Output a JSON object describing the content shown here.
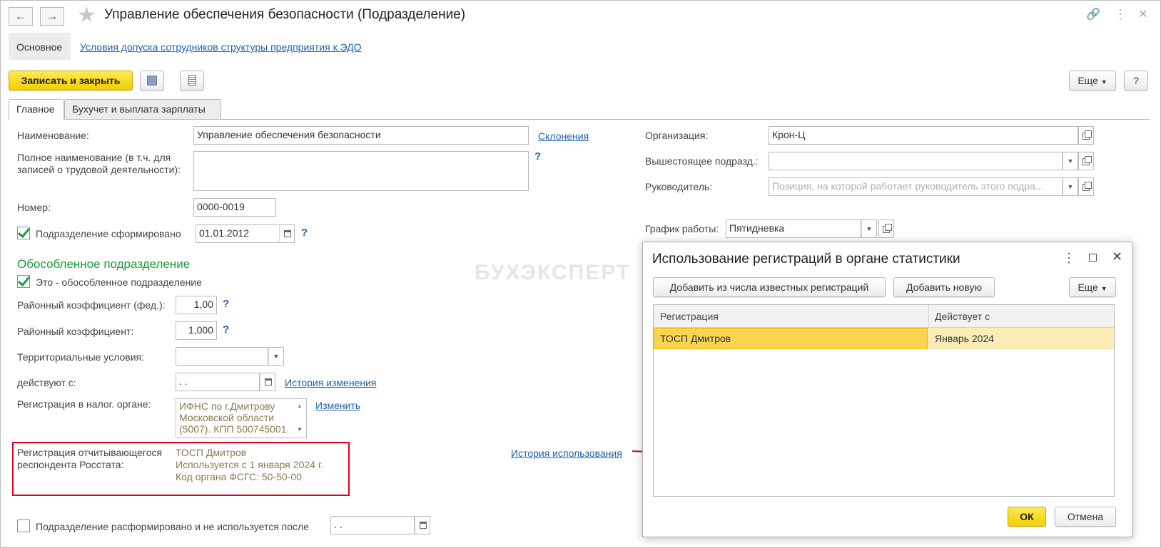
{
  "header": {
    "title": "Управление обеспечения безопасности (Подразделение)",
    "back_icon": "arrow-left-icon",
    "forward_icon": "arrow-right-icon",
    "favorite_icon": "star-icon",
    "link_icon": "link-icon",
    "more_icon": "more-vertical-icon",
    "close_icon": "close-icon"
  },
  "nav": {
    "main_tab": "Основное",
    "edo_link": "Условия допуска сотрудников структуры предприятия к ЭДО"
  },
  "toolbar": {
    "save_close": "Записать и закрыть",
    "more": "Еще",
    "help": "?"
  },
  "tabs": [
    "Главное",
    "Бухучет и выплата зарплаты"
  ],
  "form": {
    "name_label": "Наименование:",
    "name_value": "Управление обеспечения безопасности",
    "declensions_link": "Склонения",
    "fullname_label": "Полное наименование (в т.ч. для записей о трудовой деятельности):",
    "fullname_value": "",
    "number_label": "Номер:",
    "number_value": "0000-0019",
    "formed_label": "Подразделение сформировано",
    "formed_date": "01.01.2012",
    "separate_heading": "Обособленное подразделение",
    "separate_checkbox": "Это - обособленное подразделение",
    "coef_fed_label": "Районный коэффициент (фед.):",
    "coef_fed_value": "1,00",
    "coef_label": "Районный коэффициент:",
    "coef_value": "1,000",
    "terr_label": "Территориальные условия:",
    "terr_value": "",
    "valid_from_label": "действуют с:",
    "valid_from_value": " .  .",
    "history_change_link": "История изменения",
    "tax_reg_label": "Регистрация в налог. органе:",
    "tax_reg_value": "ИФНС по г.Дмитрову Московской области (5007). КПП 500745001.",
    "change_link": "Изменить",
    "rosstat_label": "Регистрация отчитывающегося респондента Росстата:",
    "rosstat_lines": [
      "ТОСП Дмитров",
      "Используется с 1 января 2024 г.",
      "Код органа ФСГС: 50-50-00"
    ],
    "history_use_link": "История использования",
    "disbanded_label": "Подразделение расформировано и не используется после",
    "disbanded_date": " .  .",
    "org_label": "Организация:",
    "org_value": "Крон-Ц",
    "parent_label": "Вышестоящее подразд.:",
    "parent_value": "",
    "head_label": "Руководитель:",
    "head_placeholder": "Позиция, на которой работает руководитель этого подра...",
    "schedule_label": "График работы:",
    "schedule_value": "Пятидневка",
    "question": "?"
  },
  "watermark": "БУХЭКСПЕРТ",
  "dialog": {
    "title": "Использование регистраций в органе статистики",
    "add_known": "Добавить из числа известных регистраций",
    "add_new": "Добавить новую",
    "more": "Еще",
    "columns": [
      "Регистрация",
      "Действует с"
    ],
    "rows": [
      {
        "registration": "ТОСП Дмитров",
        "from": "Январь 2024"
      }
    ],
    "ok": "ОК",
    "cancel": "Отмена"
  },
  "colors": {
    "accent_yellow": "#f3ce00",
    "link_blue": "#1f5fa8",
    "heading_green": "#1a9a36",
    "highlight_red": "#e3001b",
    "selected_row": "#fbedb5"
  }
}
